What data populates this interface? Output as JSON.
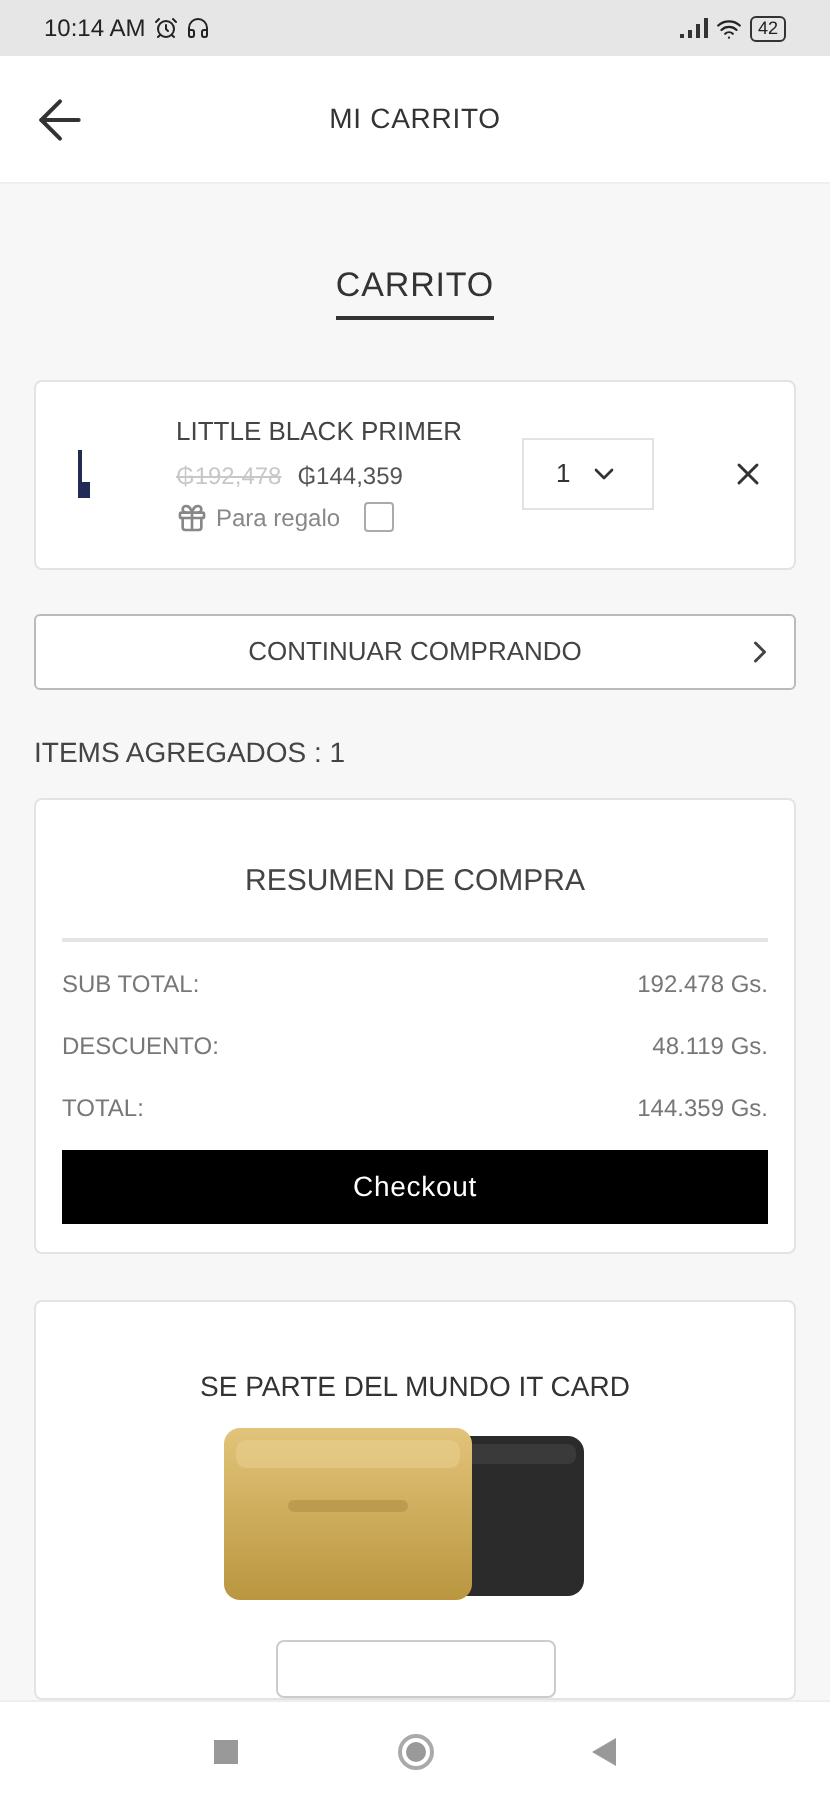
{
  "status_bar": {
    "time": "10:14 AM",
    "battery": "42"
  },
  "header": {
    "title": "MI CARRITO"
  },
  "section_title": "CARRITO",
  "cart_items": [
    {
      "name": "LITTLE BLACK PRIMER",
      "old_price": "₲192,478",
      "price": "₲144,359",
      "gift_label": "Para regalo",
      "gift_checked": false,
      "quantity": "1"
    }
  ],
  "continue_button": "CONTINUAR COMPRANDO",
  "items_count": "ITEMS AGREGADOS : 1",
  "summary": {
    "title": "RESUMEN DE COMPRA",
    "rows": [
      {
        "label": "SUB TOTAL:",
        "value": "192.478 Gs."
      },
      {
        "label": "DESCUENTO:",
        "value": "48.119 Gs."
      },
      {
        "label": "TOTAL:",
        "value": "144.359 Gs."
      }
    ],
    "button": "Checkout"
  },
  "promo": {
    "title": "SE PARTE DEL MUNDO IT CARD"
  }
}
